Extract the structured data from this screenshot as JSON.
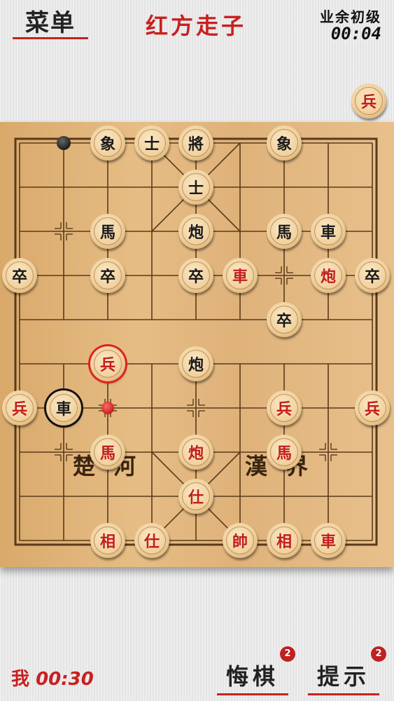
{
  "header": {
    "menu_label": "菜单",
    "turn_text": "红方走子",
    "level_text": "业余初级",
    "opponent_timer": "00:04"
  },
  "captured": {
    "char": "兵",
    "side": "red"
  },
  "board": {
    "river_left": "楚河",
    "river_right": "漢界",
    "pieces": [
      {
        "char": "象",
        "side": "black",
        "col": 2,
        "row": 0
      },
      {
        "char": "士",
        "side": "black",
        "col": 3,
        "row": 0
      },
      {
        "char": "將",
        "side": "black",
        "col": 4,
        "row": 0
      },
      {
        "char": "象",
        "side": "black",
        "col": 6,
        "row": 0
      },
      {
        "char": "士",
        "side": "black",
        "col": 4,
        "row": 1
      },
      {
        "char": "馬",
        "side": "black",
        "col": 2,
        "row": 2
      },
      {
        "char": "炮",
        "side": "black",
        "col": 4,
        "row": 2
      },
      {
        "char": "馬",
        "side": "black",
        "col": 6,
        "row": 2
      },
      {
        "char": "車",
        "side": "black",
        "col": 7,
        "row": 2
      },
      {
        "char": "卒",
        "side": "black",
        "col": 0,
        "row": 3
      },
      {
        "char": "卒",
        "side": "black",
        "col": 2,
        "row": 3
      },
      {
        "char": "卒",
        "side": "black",
        "col": 4,
        "row": 3
      },
      {
        "char": "車",
        "side": "red",
        "col": 5,
        "row": 3
      },
      {
        "char": "炮",
        "side": "red",
        "col": 7,
        "row": 3
      },
      {
        "char": "卒",
        "side": "black",
        "col": 8,
        "row": 3
      },
      {
        "char": "卒",
        "side": "black",
        "col": 6,
        "row": 4
      },
      {
        "char": "兵",
        "side": "red",
        "col": 2,
        "row": 5,
        "selected": true
      },
      {
        "char": "炮",
        "side": "black",
        "col": 4,
        "row": 5
      },
      {
        "char": "兵",
        "side": "red",
        "col": 0,
        "row": 6
      },
      {
        "char": "車",
        "side": "black",
        "col": 1,
        "row": 6,
        "selected": true
      },
      {
        "char": "兵",
        "side": "red",
        "col": 6,
        "row": 6
      },
      {
        "char": "兵",
        "side": "red",
        "col": 8,
        "row": 6
      },
      {
        "char": "馬",
        "side": "red",
        "col": 2,
        "row": 7
      },
      {
        "char": "炮",
        "side": "red",
        "col": 4,
        "row": 7
      },
      {
        "char": "馬",
        "side": "red",
        "col": 6,
        "row": 7
      },
      {
        "char": "仕",
        "side": "red",
        "col": 4,
        "row": 8
      },
      {
        "char": "相",
        "side": "red",
        "col": 2,
        "row": 9
      },
      {
        "char": "仕",
        "side": "red",
        "col": 3,
        "row": 9
      },
      {
        "char": "帥",
        "side": "red",
        "col": 5,
        "row": 9
      },
      {
        "char": "相",
        "side": "red",
        "col": 6,
        "row": 9
      },
      {
        "char": "車",
        "side": "red",
        "col": 7,
        "row": 9
      }
    ],
    "markers": [
      {
        "color": "black",
        "col": 1,
        "row": 0
      },
      {
        "color": "red",
        "col": 2,
        "row": 6
      }
    ]
  },
  "footer": {
    "my_label": "我",
    "my_timer": "00:30",
    "undo_label": "悔棋",
    "undo_count": "2",
    "hint_label": "提示",
    "hint_count": "2"
  }
}
